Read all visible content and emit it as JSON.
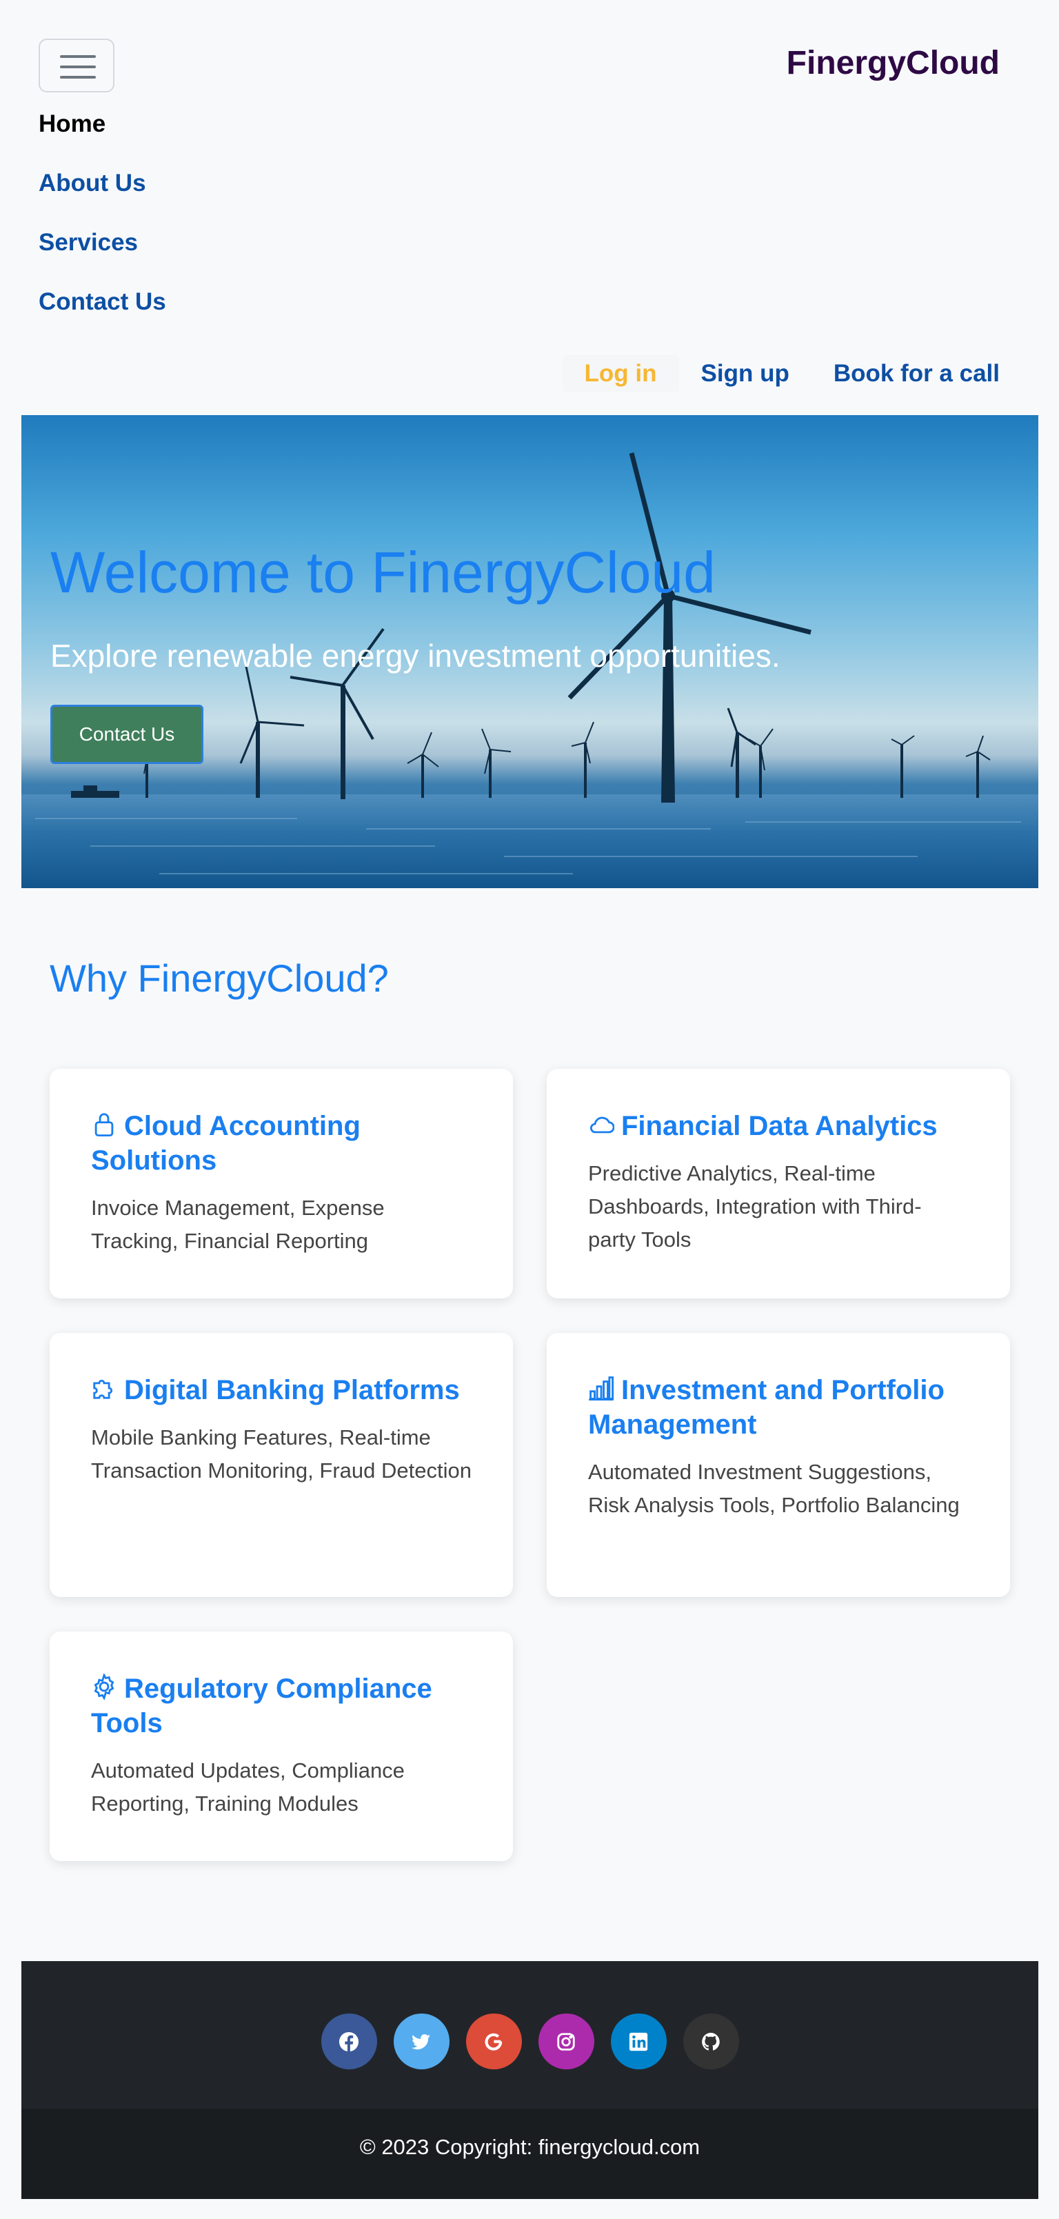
{
  "header": {
    "brand": "FinergyCloud",
    "nav": [
      {
        "label": "Home",
        "active": true
      },
      {
        "label": "About Us"
      },
      {
        "label": "Services"
      },
      {
        "label": "Contact Us"
      }
    ],
    "auth": {
      "login": "Log in",
      "signup": "Sign up",
      "book": "Book for a call"
    }
  },
  "hero": {
    "title": "Welcome to FinergyCloud",
    "subtitle": "Explore renewable energy investment opportunities.",
    "button": "Contact Us"
  },
  "why": {
    "title": "Why FinergyCloud?",
    "cards": [
      {
        "icon": "lock-icon",
        "title": "Cloud Accounting Solutions",
        "text": "Invoice Management, Expense Tracking, Financial Reporting"
      },
      {
        "icon": "cloud-icon",
        "title": "Financial Data Analytics",
        "text": "Predictive Analytics, Real-time Dashboards, Integration with Third-party Tools"
      },
      {
        "icon": "puzzle-icon",
        "title": "Digital Banking Platforms",
        "text": "Mobile Banking Features, Real-time Transaction Monitoring, Fraud Detection"
      },
      {
        "icon": "bar-chart-icon",
        "title": "Investment and Portfolio Management",
        "text": "Automated Investment Suggestions, Risk Analysis Tools, Portfolio Balancing"
      },
      {
        "icon": "gear-icon",
        "title": "Regulatory Compliance Tools",
        "text": "Automated Updates, Compliance Reporting, Training Modules"
      }
    ]
  },
  "footer": {
    "socials": [
      {
        "icon": "facebook-icon",
        "color": "#3b5998"
      },
      {
        "icon": "twitter-icon",
        "color": "#55acee"
      },
      {
        "icon": "google-icon",
        "color": "#dd4b39"
      },
      {
        "icon": "instagram-icon",
        "color": "#ac2bac"
      },
      {
        "icon": "linkedin-icon",
        "color": "#0082ca"
      },
      {
        "icon": "github-icon",
        "color": "#333333"
      }
    ],
    "copyright": "© 2023 Copyright: finergycloud.com"
  }
}
